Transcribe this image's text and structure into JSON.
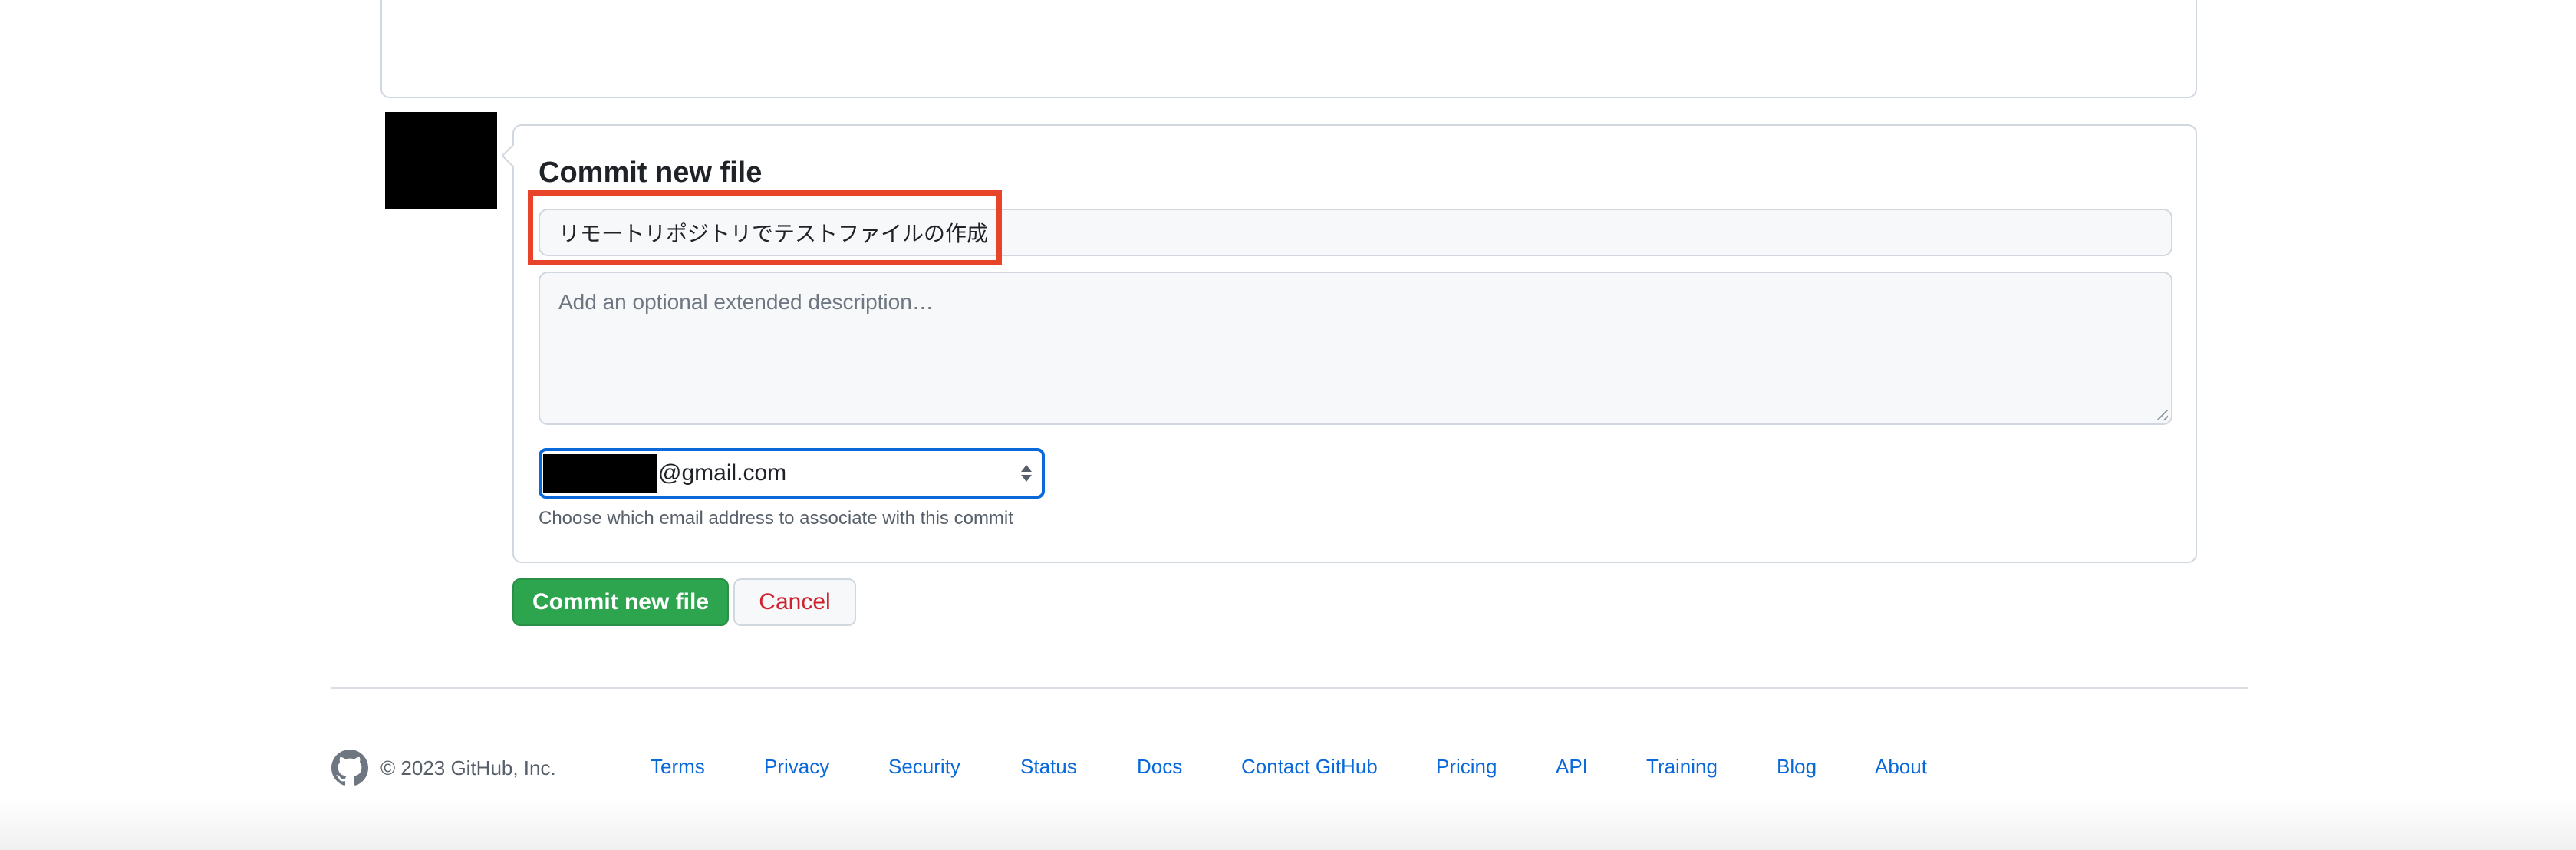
{
  "commit": {
    "title": "Commit new file",
    "summary_value": "リモートリポジトリでテストファイルの作成",
    "description_placeholder": "Add an optional extended description…",
    "email_domain": "@gmail.com",
    "email_note": "Choose which email address to associate with this commit",
    "commit_button": "Commit new file",
    "cancel_button": "Cancel"
  },
  "footer": {
    "copyright": "© 2023 GitHub, Inc.",
    "links": [
      "Terms",
      "Privacy",
      "Security",
      "Status",
      "Docs",
      "Contact GitHub",
      "Pricing",
      "API",
      "Training",
      "Blog",
      "About"
    ]
  },
  "colors": {
    "accent": "#0969da",
    "commit_green": "#2da44e",
    "cancel_red": "#cf222e",
    "highlight": "#e8442a"
  },
  "icons": [
    "github-logo-icon",
    "select-arrows-icon"
  ]
}
